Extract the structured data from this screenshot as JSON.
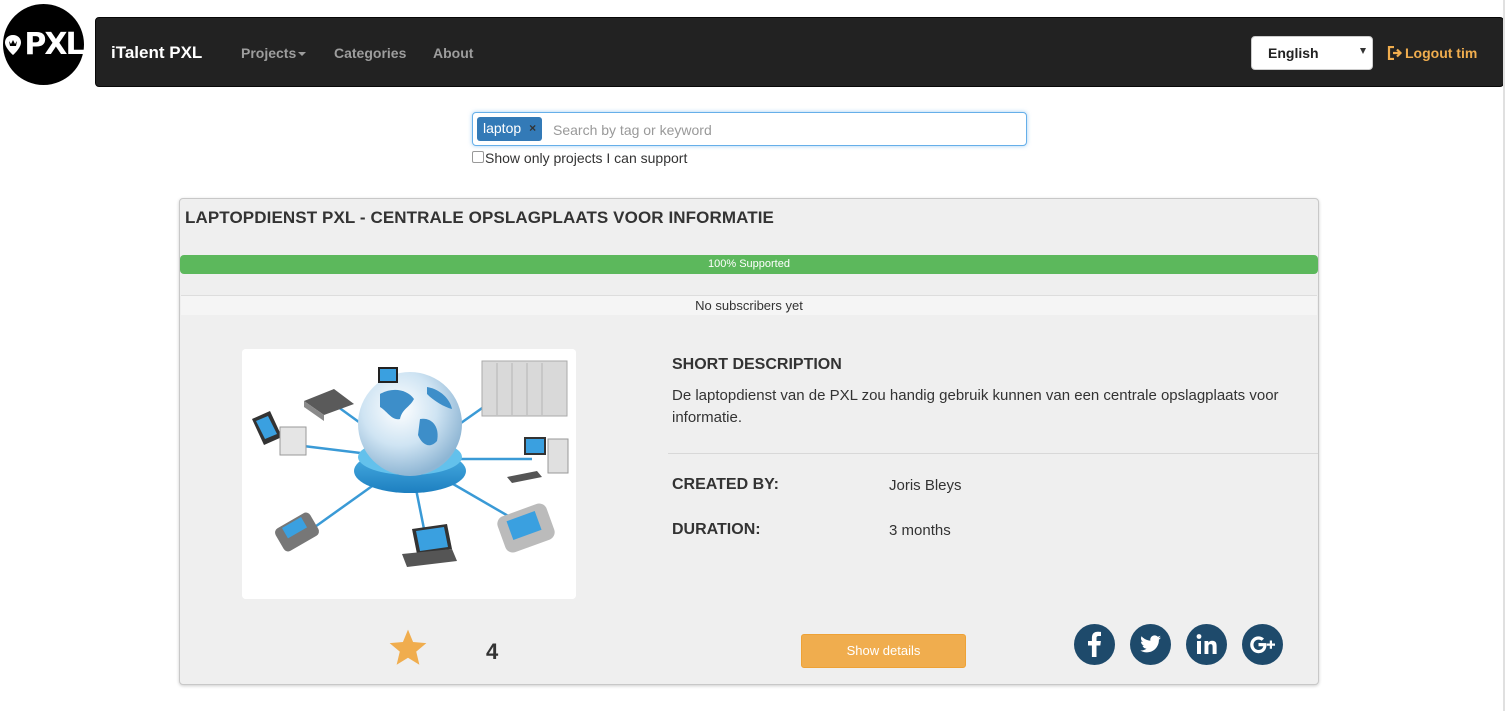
{
  "logo": {
    "text": "PXL"
  },
  "navbar": {
    "brand": "iTalent PXL",
    "items": [
      {
        "label": "Projects",
        "has_caret": true
      },
      {
        "label": "Categories",
        "has_caret": false
      },
      {
        "label": "About",
        "has_caret": false
      }
    ],
    "language": {
      "selected": "English"
    },
    "logout_label": "Logout tim"
  },
  "search": {
    "tag": "laptop",
    "tag_remove": "×",
    "placeholder": "Search by tag or keyword",
    "value": "",
    "support_only_label": "Show only projects I can support",
    "support_only_checked": false
  },
  "project": {
    "title": "LAPTOPDIENST PXL - CENTRALE OPSLAGPLAATS VOOR INFORMATIE",
    "progress": {
      "percent": 100,
      "label": "100% Supported"
    },
    "subscribers_text": "No subscribers yet",
    "short_description_title": "SHORT DESCRIPTION",
    "short_description": "De laptopdienst van de PXL zou handig gebruik kunnen van een centrale opslagplaats voor informatie.",
    "created_by_label": "CREATED BY:",
    "created_by": "Joris Bleys",
    "duration_label": "DURATION:",
    "duration": "3 months",
    "rating": "4",
    "details_button": "Show details",
    "social": [
      "facebook-icon",
      "twitter-icon",
      "linkedin-icon",
      "google-plus-icon"
    ]
  },
  "colors": {
    "navbar_bg": "#222222",
    "accent_orange": "#f0ad4e",
    "progress_green": "#5cb85c",
    "tag_blue": "#337ab7",
    "social_bg": "#1e4a6b",
    "star": "#f0ad4e"
  }
}
